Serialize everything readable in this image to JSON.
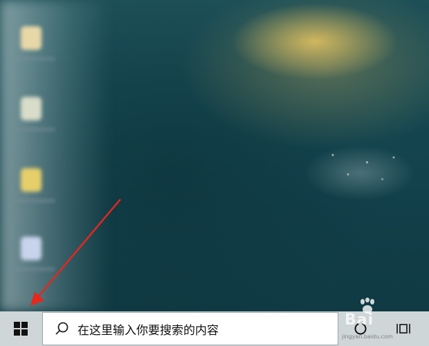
{
  "taskbar": {
    "start": {
      "icon": "windows-logo-icon"
    },
    "search": {
      "placeholder": "在这里输入你要搜索的内容",
      "icon": "search-icon"
    },
    "cortana": {
      "icon": "cortana-circle-icon"
    },
    "task_view": {
      "icon": "task-view-icon"
    }
  },
  "desktop": {
    "icons": [
      "blurred-desktop-icon",
      "blurred-desktop-icon",
      "blurred-desktop-icon",
      "blurred-desktop-icon"
    ],
    "annotation": {
      "icon": "red-arrow-icon",
      "color": "#e8261c"
    }
  },
  "watermark": {
    "text": "Bai",
    "sub": "jingyan.baidu.com"
  },
  "colors": {
    "taskbar": "#cfd6d8",
    "search_bg": "#ffffff",
    "arrow": "#e8261c"
  }
}
